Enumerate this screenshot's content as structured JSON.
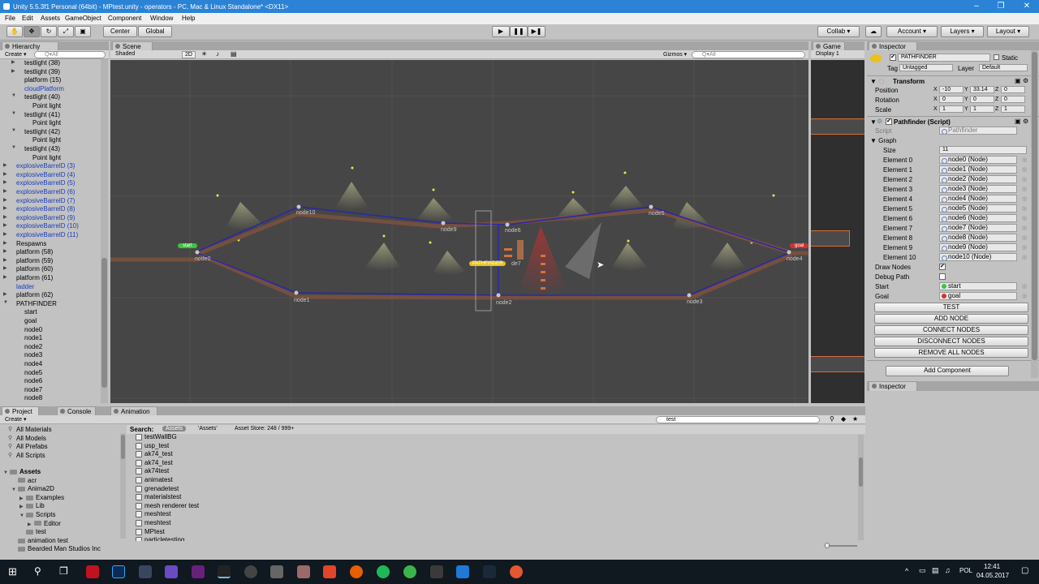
{
  "window": {
    "title": "Unity 5.5.3f1 Personal (64bit) - MPtest.unity - operators - PC, Mac & Linux Standalone* <DX11>"
  },
  "menu": [
    "File",
    "Edit",
    "Assets",
    "GameObject",
    "Component",
    "Window",
    "Help"
  ],
  "toolbar": {
    "center": "Center",
    "global": "Global",
    "collab": "Collab ▾",
    "account": "Account",
    "layers": "Layers",
    "layout": "Layout"
  },
  "hierarchy": {
    "tab": "Hierarchy",
    "create": "Create ▾",
    "search": "Q▾All",
    "items": [
      {
        "label": "testlight (38)",
        "indent": 1,
        "arrow": "▶",
        "blue": false
      },
      {
        "label": "testlight (39)",
        "indent": 1,
        "arrow": "▶",
        "blue": false
      },
      {
        "label": "platform (15)",
        "indent": 1,
        "arrow": "",
        "blue": false
      },
      {
        "label": "cloudPlatform",
        "indent": 1,
        "arrow": "",
        "blue": true
      },
      {
        "label": "testlight (40)",
        "indent": 1,
        "arrow": "▼",
        "blue": false
      },
      {
        "label": "Point light",
        "indent": 2,
        "arrow": "",
        "blue": false
      },
      {
        "label": "testlight (41)",
        "indent": 1,
        "arrow": "▼",
        "blue": false
      },
      {
        "label": "Point light",
        "indent": 2,
        "arrow": "",
        "blue": false
      },
      {
        "label": "testlight (42)",
        "indent": 1,
        "arrow": "▼",
        "blue": false
      },
      {
        "label": "Point light",
        "indent": 2,
        "arrow": "",
        "blue": false
      },
      {
        "label": "testlight (43)",
        "indent": 1,
        "arrow": "▼",
        "blue": false
      },
      {
        "label": "Point light",
        "indent": 2,
        "arrow": "",
        "blue": false
      },
      {
        "label": "explosiveBarrelD (3)",
        "indent": 0,
        "arrow": "▶",
        "blue": true
      },
      {
        "label": "explosiveBarrelD (4)",
        "indent": 0,
        "arrow": "▶",
        "blue": true
      },
      {
        "label": "explosiveBarrelD (5)",
        "indent": 0,
        "arrow": "▶",
        "blue": true
      },
      {
        "label": "explosiveBarrelD (6)",
        "indent": 0,
        "arrow": "▶",
        "blue": true
      },
      {
        "label": "explosiveBarrelD (7)",
        "indent": 0,
        "arrow": "▶",
        "blue": true
      },
      {
        "label": "explosiveBarrelD (8)",
        "indent": 0,
        "arrow": "▶",
        "blue": true
      },
      {
        "label": "explosiveBarrelD (9)",
        "indent": 0,
        "arrow": "▶",
        "blue": true
      },
      {
        "label": "explosiveBarrelD (10)",
        "indent": 0,
        "arrow": "▶",
        "blue": true
      },
      {
        "label": "explosiveBarrelD (11)",
        "indent": 0,
        "arrow": "▶",
        "blue": true
      },
      {
        "label": "Respawns",
        "indent": 0,
        "arrow": "▶",
        "blue": false
      },
      {
        "label": "platform (58)",
        "indent": 0,
        "arrow": "▶",
        "blue": false
      },
      {
        "label": "platform (59)",
        "indent": 0,
        "arrow": "▶",
        "blue": false
      },
      {
        "label": "platform (60)",
        "indent": 0,
        "arrow": "▶",
        "blue": false
      },
      {
        "label": "platform (61)",
        "indent": 0,
        "arrow": "▶",
        "blue": false
      },
      {
        "label": "ladder",
        "indent": 0,
        "arrow": "",
        "blue": true
      },
      {
        "label": "platform (62)",
        "indent": 0,
        "arrow": "▶",
        "blue": false
      },
      {
        "label": "PATHFINDER",
        "indent": 0,
        "arrow": "▼",
        "blue": false
      },
      {
        "label": "start",
        "indent": 1,
        "arrow": "",
        "blue": false
      },
      {
        "label": "goal",
        "indent": 1,
        "arrow": "",
        "blue": false
      },
      {
        "label": "node0",
        "indent": 1,
        "arrow": "",
        "blue": false
      },
      {
        "label": "node1",
        "indent": 1,
        "arrow": "",
        "blue": false
      },
      {
        "label": "node2",
        "indent": 1,
        "arrow": "",
        "blue": false
      },
      {
        "label": "node3",
        "indent": 1,
        "arrow": "",
        "blue": false
      },
      {
        "label": "node4",
        "indent": 1,
        "arrow": "",
        "blue": false
      },
      {
        "label": "node5",
        "indent": 1,
        "arrow": "",
        "blue": false
      },
      {
        "label": "node6",
        "indent": 1,
        "arrow": "",
        "blue": false
      },
      {
        "label": "node7",
        "indent": 1,
        "arrow": "",
        "blue": false
      },
      {
        "label": "node8",
        "indent": 1,
        "arrow": "",
        "blue": false
      }
    ]
  },
  "scene": {
    "tab": "Scene",
    "shaded": "Shaded",
    "mode2d": "2D",
    "gizmos": "Gizmos ▾",
    "search": "Q▾All",
    "labels": {
      "node10": "node10",
      "node9": "node9",
      "node6": "node6",
      "node5": "node5",
      "node0": "node0",
      "node4": "node4",
      "node1": "node1",
      "node2": "node2",
      "node3": "node3",
      "start": "start",
      "goal": "goal",
      "pathfinder": "PATHFINDER",
      "node7": "de7"
    }
  },
  "game": {
    "tab": "Game",
    "display": "Display 1"
  },
  "inspector": {
    "tab": "Inspector",
    "object_name": "PATHFINDER",
    "static": "Static",
    "tag_label": "Tag",
    "tag": "Untagged",
    "layer_label": "Layer",
    "layer": "Default",
    "transform_title": "Transform",
    "position_label": "Position",
    "rotation_label": "Rotation",
    "scale_label": "Scale",
    "axis_x": "X",
    "axis_y": "Y",
    "axis_z": "Z",
    "position": [
      "-10",
      "33.14",
      "0"
    ],
    "rotation": [
      "0",
      "0",
      "0"
    ],
    "scale": [
      "1",
      "1",
      "1"
    ],
    "script_title": "Pathfinder (Script)",
    "script_label": "Script",
    "script_value": "Pathfinder",
    "graph_label": "Graph",
    "size_label": "Size",
    "size": "11",
    "elements": [
      {
        "label": "Element 0",
        "value": "node0 (Node)"
      },
      {
        "label": "Element 1",
        "value": "node1 (Node)"
      },
      {
        "label": "Element 2",
        "value": "node2 (Node)"
      },
      {
        "label": "Element 3",
        "value": "node3 (Node)"
      },
      {
        "label": "Element 4",
        "value": "node4 (Node)"
      },
      {
        "label": "Element 5",
        "value": "node5 (Node)"
      },
      {
        "label": "Element 6",
        "value": "node6 (Node)"
      },
      {
        "label": "Element 7",
        "value": "node7 (Node)"
      },
      {
        "label": "Element 8",
        "value": "node8 (Node)"
      },
      {
        "label": "Element 9",
        "value": "node9 (Node)"
      },
      {
        "label": "Element 10",
        "value": "node10 (Node)"
      }
    ],
    "draw_nodes_label": "Draw Nodes",
    "draw_nodes": true,
    "debug_path_label": "Debug Path",
    "debug_path": false,
    "start_label": "Start",
    "start_value": "start",
    "goal_label": "Goal",
    "goal_value": "goal",
    "buttons": [
      "TEST",
      "ADD NODE",
      "CONNECT NODES",
      "DISCONNECT NODES",
      "REMOVE ALL NODES"
    ],
    "add_component": "Add Component",
    "second_tab": "Inspector"
  },
  "project": {
    "tab_project": "Project",
    "tab_console": "Console",
    "tab_animation": "Animation",
    "create": "Create ▾",
    "search_value": "test",
    "search_label": "Search:",
    "scope_assets": "Assets",
    "scope_assets_quoted": "'Assets'",
    "asset_store": "Asset Store: 248 / 999+",
    "favorites": [
      "All Materials",
      "All Models",
      "All Prefabs",
      "All Scripts"
    ],
    "tree": [
      {
        "label": "Assets",
        "indent": 0,
        "bold": true
      },
      {
        "label": "acr",
        "indent": 1,
        "bold": false
      },
      {
        "label": "Anima2D",
        "indent": 1,
        "bold": false
      },
      {
        "label": "Examples",
        "indent": 2,
        "bold": false
      },
      {
        "label": "Lib",
        "indent": 2,
        "bold": false
      },
      {
        "label": "Scripts",
        "indent": 2,
        "bold": false
      },
      {
        "label": "Editor",
        "indent": 3,
        "bold": false
      },
      {
        "label": "test",
        "indent": 2,
        "bold": false
      },
      {
        "label": "animation test",
        "indent": 1,
        "bold": false
      },
      {
        "label": "Bearded Man Studios Inc",
        "indent": 1,
        "bold": false
      }
    ],
    "results": [
      "testWallBG",
      "usp_test",
      "ak74_test",
      "ak74_test",
      "ak74test",
      "animatest",
      "grenadetest",
      "materialstest",
      "mesh renderer test",
      "meshtest",
      "meshtest",
      "MPtest",
      "particletesting"
    ]
  },
  "taskbar": {
    "time": "12:41",
    "date": "04.05.2017",
    "lang": "POL"
  }
}
